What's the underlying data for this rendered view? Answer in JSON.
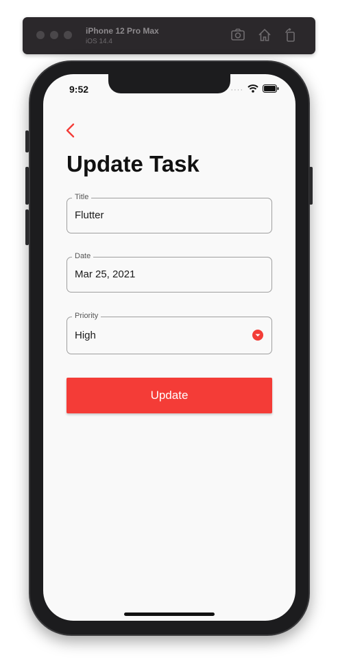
{
  "simulator": {
    "device_name": "iPhone 12 Pro Max",
    "os_version": "iOS 14.4",
    "icons": [
      "screenshot-icon",
      "home-icon",
      "rotate-icon"
    ]
  },
  "status_bar": {
    "time": "9:52",
    "icons": [
      "signal-icon",
      "wifi-icon",
      "battery-icon"
    ]
  },
  "page": {
    "title": "Update Task",
    "accent_color": "#f43c37"
  },
  "form": {
    "title_field": {
      "label": "Title",
      "value": "Flutter"
    },
    "date_field": {
      "label": "Date",
      "value": "Mar 25, 2021"
    },
    "priority_field": {
      "label": "Priority",
      "value": "High"
    },
    "submit_label": "Update"
  }
}
